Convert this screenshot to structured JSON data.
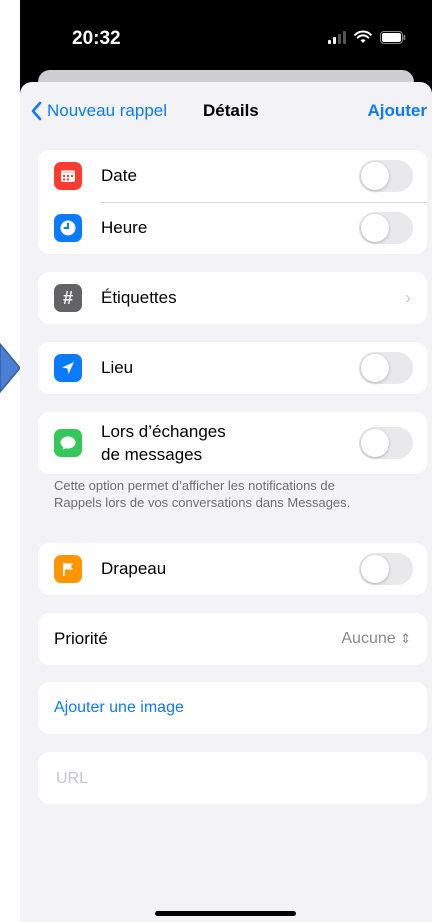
{
  "status_bar": {
    "time": "20:32",
    "icons": [
      "signal-icon",
      "wifi-icon",
      "battery-icon"
    ]
  },
  "nav": {
    "back_label": "Nouveau rappel",
    "title": "Détails",
    "add_label": "Ajouter"
  },
  "date_time_group": {
    "date": {
      "label": "Date",
      "icon": "calendar-icon",
      "color": "#ff3b30",
      "on": false
    },
    "time": {
      "label": "Heure",
      "icon": "clock-icon",
      "color": "#0a7aff",
      "on": false
    }
  },
  "tags": {
    "label": "Étiquettes",
    "icon": "hashtag-icon",
    "color": "#636366"
  },
  "location": {
    "label": "Lieu",
    "icon": "location-arrow-icon",
    "color": "#0a7aff",
    "on": false
  },
  "messaging": {
    "label_line1": "Lors d’échanges",
    "label_line2": "de messages",
    "icon": "message-bubble-icon",
    "color": "#34c759",
    "on": false,
    "footnote_line1": "Cette option permet d’afficher les notifications de",
    "footnote_line2": "Rappels lors de vos conversations dans Messages."
  },
  "flag": {
    "label": "Drapeau",
    "icon": "flag-icon",
    "color": "#ff9500",
    "on": false
  },
  "priority": {
    "label": "Priorité",
    "value": "Aucune"
  },
  "image": {
    "label": "Ajouter une image"
  },
  "url": {
    "placeholder": "URL",
    "value": ""
  },
  "accent_color": "#0a7aff"
}
